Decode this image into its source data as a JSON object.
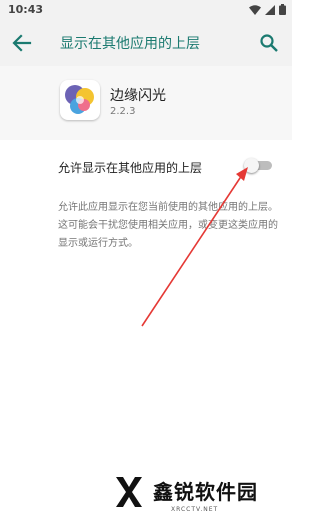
{
  "status_bar": {
    "time": "10:43"
  },
  "app_bar": {
    "title": "显示在其他应用的上层"
  },
  "app_info": {
    "name": "边缘闪光",
    "version": "2.2.3"
  },
  "setting": {
    "toggle_label": "允许显示在其他应用的上层",
    "toggle_on": false,
    "description": "允许此应用显示在您当前使用的其他应用的上层。这可能会干扰您使用相关应用，或变更这类应用的显示或运行方式。"
  },
  "watermark": {
    "brand": "鑫锐软件园",
    "url": "XRCCTV.NET"
  },
  "colors": {
    "accent": "#1b7a70",
    "annotation_arrow": "#e53935"
  },
  "icons": [
    "back-arrow-icon",
    "search-icon",
    "wifi-icon",
    "signal-icon",
    "battery-icon"
  ]
}
